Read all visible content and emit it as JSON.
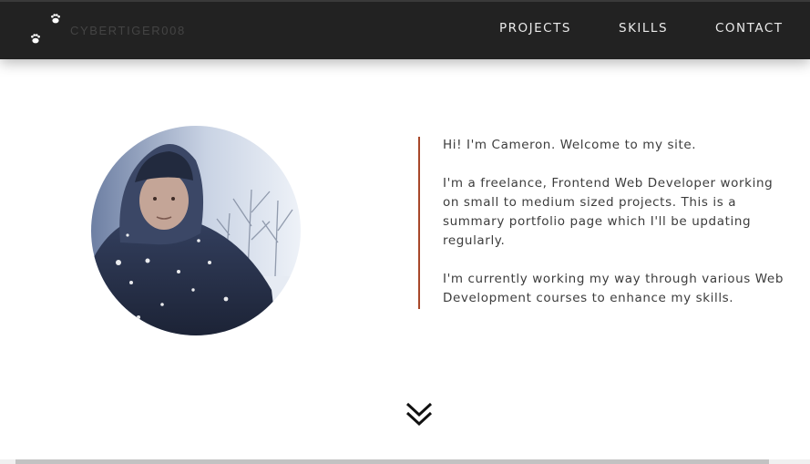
{
  "header": {
    "brand": "CYBERTIGER008",
    "logo_icon": "paw-prints-icon",
    "nav": [
      {
        "label": "PROJECTS"
      },
      {
        "label": "SKILLS"
      },
      {
        "label": "CONTACT"
      }
    ]
  },
  "hero": {
    "photo_icon": "profile-photo",
    "paragraphs": [
      "Hi! I'm Cameron. Welcome to my site.",
      "I'm a freelance, Frontend Web Developer working on small to medium sized projects. This is a summary portfolio page which I'll be updating regularly.",
      "I'm currently working my way through various Web Development courses to enhance my skills."
    ],
    "accent_color": "#a8482a"
  },
  "scroll_down_icon": "double-chevron-down-icon",
  "colors": {
    "topbar": "#222222",
    "nav_text": "#eaeaea",
    "body_text": "#3c3c3c"
  }
}
